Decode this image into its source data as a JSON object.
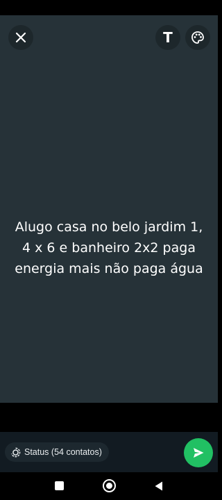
{
  "composer": {
    "background_color": "#263238",
    "text": "Alugo casa no belo jardim 1, 4 x 6 e banheiro 2x2 paga energia mais não paga água",
    "close_icon": "close-icon",
    "text_style_label": "T",
    "palette_icon": "palette-icon"
  },
  "footer": {
    "audience_icon": "status-icon",
    "audience_label": "Status (54 contatos)",
    "send_icon": "send-icon",
    "send_color": "#21c063"
  },
  "navigation": {
    "recents_icon": "square-recents-icon",
    "home_icon": "circle-home-icon",
    "back_icon": "triangle-back-icon"
  }
}
